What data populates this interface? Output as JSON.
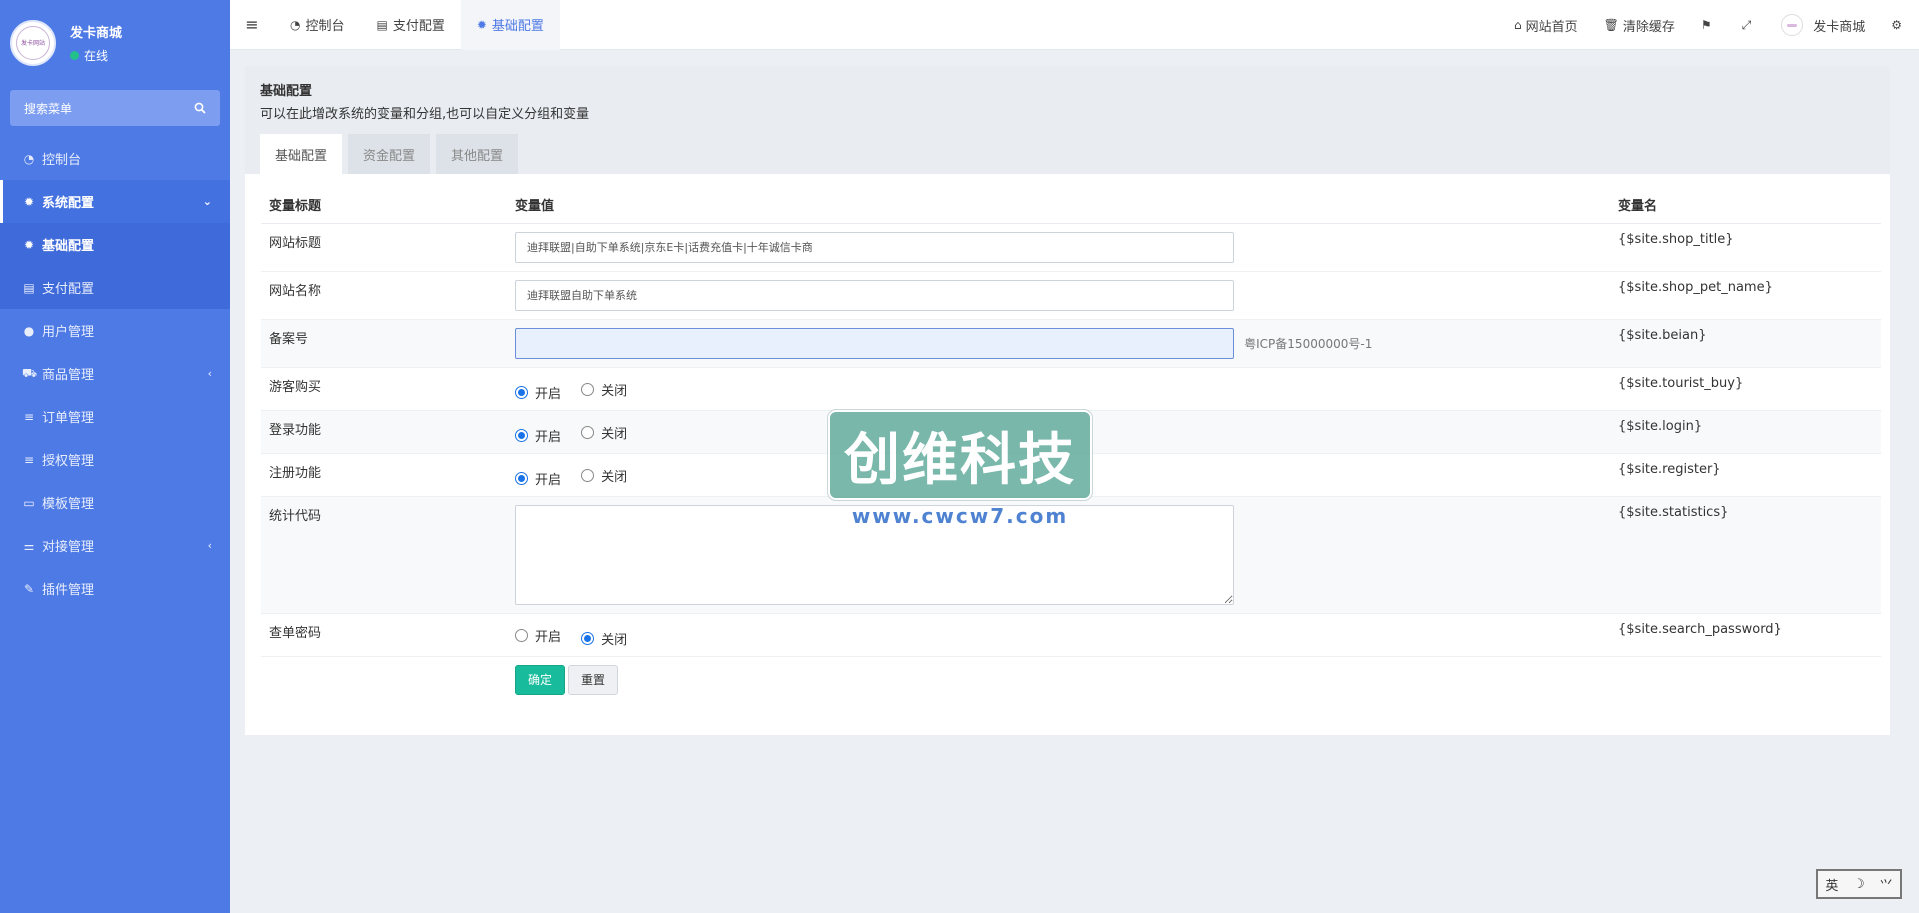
{
  "sidebar": {
    "avatar_text": "发卡网站",
    "user_name": "发卡商城",
    "status": "在线",
    "search_placeholder": "搜索菜单",
    "items": [
      {
        "label": "控制台",
        "icon": "dashboard-icon"
      },
      {
        "label": "系统配置",
        "icon": "gear-icon"
      },
      {
        "label": "基础配置",
        "icon": "gear-icon"
      },
      {
        "label": "支付配置",
        "icon": "server-icon"
      },
      {
        "label": "用户管理",
        "icon": "user-icon"
      },
      {
        "label": "商品管理",
        "icon": "cart-icon"
      },
      {
        "label": "订单管理",
        "icon": "list-icon"
      },
      {
        "label": "授权管理",
        "icon": "list-icon"
      },
      {
        "label": "模板管理",
        "icon": "card-icon"
      },
      {
        "label": "对接管理",
        "icon": "sliders-icon"
      },
      {
        "label": "插件管理",
        "icon": "plug-icon"
      }
    ]
  },
  "topbar": {
    "tabs": [
      "控制台",
      "支付配置",
      "基础配置"
    ],
    "right": {
      "home": "网站首页",
      "clear_cache": "清除缓存",
      "user": "发卡商城"
    }
  },
  "panel": {
    "title": "基础配置",
    "desc": "可以在此增改系统的变量和分组,也可以自定义分组和变量",
    "tabs": [
      "基础配置",
      "资金配置",
      "其他配置"
    ]
  },
  "table": {
    "headers": [
      "变量标题",
      "变量值",
      "变量名"
    ],
    "rows": {
      "shop_title": {
        "label": "网站标题",
        "value": "迪拜联盟|自助下单系统|京东E卡|话费充值卡|十年诚信卡商",
        "var": "{$site.shop_title}"
      },
      "shop_pet_name": {
        "label": "网站名称",
        "value": "迪拜联盟自助下单系统",
        "var": "{$site.shop_pet_name}"
      },
      "beian": {
        "label": "备案号",
        "value": "",
        "help": "粤ICP备15000000号-1",
        "var": "{$site.beian}"
      },
      "tourist_buy": {
        "label": "游客购买",
        "var": "{$site.tourist_buy}"
      },
      "login": {
        "label": "登录功能",
        "var": "{$site.login}"
      },
      "register": {
        "label": "注册功能",
        "var": "{$site.register}"
      },
      "statistics": {
        "label": "统计代码",
        "var": "{$site.statistics}"
      },
      "search_password": {
        "label": "查单密码",
        "var": "{$site.search_password}"
      }
    },
    "radio_on": "开启",
    "radio_off": "关闭"
  },
  "buttons": {
    "ok": "确定",
    "reset": "重置"
  },
  "watermark": {
    "title": "创维科技",
    "url": "www.cwcw7.com"
  },
  "ime": {
    "lang": "英",
    "moon": "☽",
    "hand": "⺍"
  }
}
